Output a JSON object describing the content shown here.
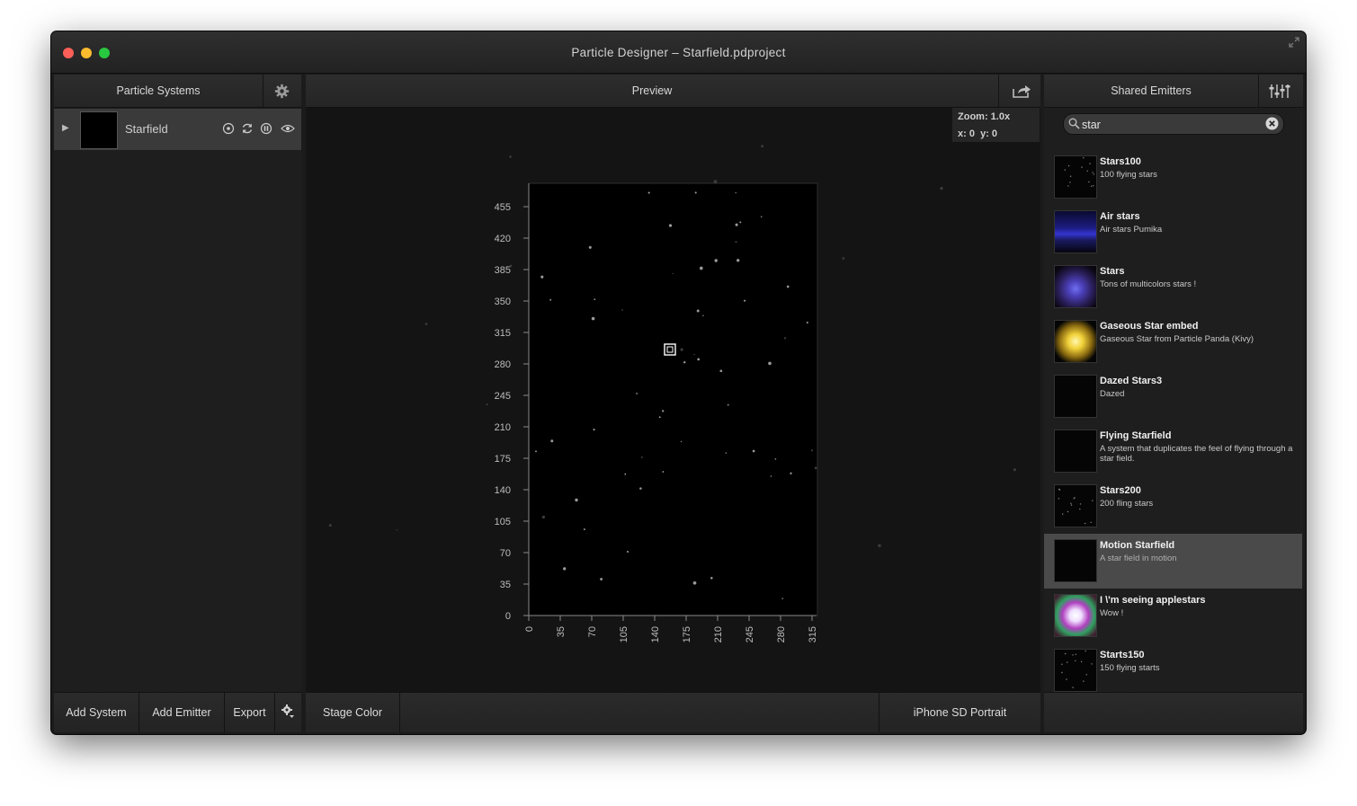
{
  "window": {
    "title": "Particle Designer – Starfield.pdproject"
  },
  "left_panel": {
    "header": "Particle Systems",
    "systems": [
      {
        "name": "Starfield",
        "expanded": false
      }
    ],
    "footer": {
      "add_system": "Add System",
      "add_emitter": "Add Emitter",
      "export": "Export"
    }
  },
  "center_panel": {
    "header": "Preview",
    "zoom": "Zoom: 1.0x",
    "coords": "x: 0  y: 0",
    "footer": {
      "stage_color": "Stage Color",
      "device": "iPhone SD Portrait"
    },
    "ruler": {
      "x_ticks": [
        "0",
        "35",
        "70",
        "105",
        "140",
        "175",
        "210",
        "245",
        "280",
        "315"
      ],
      "y_ticks": [
        "0",
        "35",
        "70",
        "105",
        "140",
        "175",
        "210",
        "245",
        "280",
        "315",
        "350",
        "385",
        "420",
        "455"
      ]
    }
  },
  "right_panel": {
    "header": "Shared Emitters",
    "search": {
      "value": "star",
      "placeholder": ""
    },
    "emitters": [
      {
        "name": "Stars100",
        "desc": "100 flying stars",
        "thumb": "sparse-dots",
        "selected": false
      },
      {
        "name": "Air stars",
        "desc": "Air stars Pumika",
        "thumb": "blue-band",
        "selected": false
      },
      {
        "name": "Stars",
        "desc": "Tons of multicolors stars !",
        "thumb": "purple-burst",
        "selected": false
      },
      {
        "name": "Gaseous Star embed",
        "desc": "Gaseous Star from Particle Panda (Kivy)",
        "thumb": "yellow-glow",
        "selected": false
      },
      {
        "name": "Dazed Stars3",
        "desc": "Dazed",
        "thumb": "black",
        "selected": false
      },
      {
        "name": "Flying Starfield",
        "desc": "A system that duplicates the feel of flying through a star field.",
        "thumb": "black",
        "selected": false
      },
      {
        "name": "Stars200",
        "desc": "200 fling stars",
        "thumb": "sparse-dots",
        "selected": false
      },
      {
        "name": "Motion Starfield",
        "desc": "A star field in motion",
        "thumb": "black",
        "selected": true
      },
      {
        "name": "I \\'m seeing applestars",
        "desc": "Wow !",
        "thumb": "colorful",
        "selected": false
      },
      {
        "name": "Starts150",
        "desc": "150 flying starts",
        "thumb": "sparse-dots",
        "selected": false
      }
    ]
  },
  "colors": {
    "window_bg": "#1b1b1b",
    "selected_row": "#4a4a4a",
    "stage_bg": "#000000"
  }
}
